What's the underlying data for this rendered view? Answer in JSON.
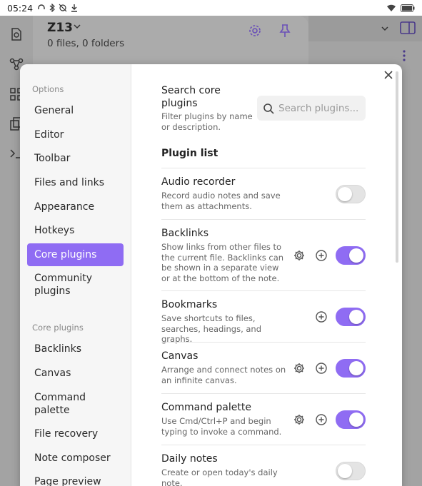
{
  "status_bar": {
    "time": "05:24"
  },
  "vault": {
    "name": "Z13",
    "summary": "0 files, 0 folders"
  },
  "settings_sidebar": {
    "options_heading": "Options",
    "options": [
      {
        "label": "General"
      },
      {
        "label": "Editor"
      },
      {
        "label": "Toolbar"
      },
      {
        "label": "Files and links"
      },
      {
        "label": "Appearance"
      },
      {
        "label": "Hotkeys"
      },
      {
        "label": "Core plugins",
        "active": true
      },
      {
        "label": "Community plugins"
      }
    ],
    "core_heading": "Core plugins",
    "core_items": [
      {
        "label": "Backlinks"
      },
      {
        "label": "Canvas"
      },
      {
        "label": "Command palette"
      },
      {
        "label": "File recovery"
      },
      {
        "label": "Note composer"
      },
      {
        "label": "Page preview"
      }
    ]
  },
  "search": {
    "title": "Search core plugins",
    "description": "Filter plugins by name or description.",
    "placeholder": "Search plugins..."
  },
  "plugin_list": {
    "title": "Plugin list",
    "plugins": [
      {
        "name": "Audio recorder",
        "description": "Record audio notes and save them as attachments.",
        "settings": false,
        "hotkeys": false,
        "enabled": false
      },
      {
        "name": "Backlinks",
        "description": "Show links from other files to the current file. Backlinks can be shown in a separate view or at the bottom of the note.",
        "settings": true,
        "hotkeys": true,
        "enabled": true
      },
      {
        "name": "Bookmarks",
        "description": "Save shortcuts to files, searches, headings, and graphs.",
        "settings": false,
        "hotkeys": true,
        "enabled": true
      },
      {
        "name": "Canvas",
        "description": "Arrange and connect notes on an infinite canvas.",
        "settings": true,
        "hotkeys": true,
        "enabled": true
      },
      {
        "name": "Command palette",
        "description": "Use Cmd/Ctrl+P and begin typing to invoke a command.",
        "settings": true,
        "hotkeys": true,
        "enabled": true
      },
      {
        "name": "Daily notes",
        "description": "Create or open today's daily note.",
        "settings": false,
        "hotkeys": false,
        "enabled": false
      }
    ]
  },
  "colors": {
    "accent": "#8f6cf3",
    "toggle_off": "#e4e4e4"
  }
}
